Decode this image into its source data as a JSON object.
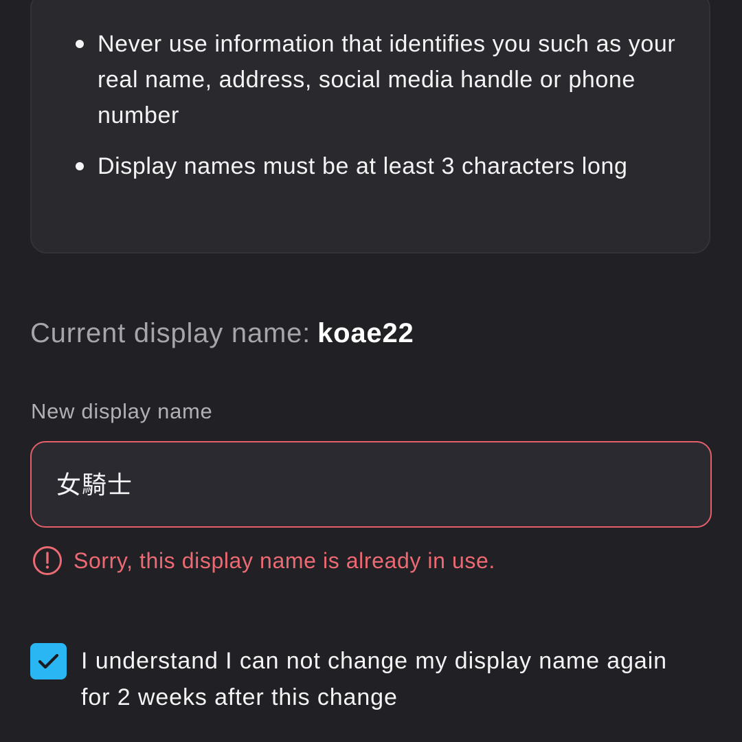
{
  "rules": {
    "items": [
      {
        "text": "Never use information that identifies you such as your real name, address, social media handle or phone number"
      },
      {
        "text": "Display names must be at least 3 characters long"
      }
    ]
  },
  "current_name": {
    "label": "Current display name:",
    "value": "koae22"
  },
  "new_name": {
    "label": "New display name",
    "value": "女騎士",
    "state": "error"
  },
  "error": {
    "icon": "alert-circle-icon",
    "message": "Sorry, this display name is already in use."
  },
  "consent": {
    "checked": true,
    "text": "I understand I can not change my display name again for 2 weeks after this change"
  },
  "colors": {
    "background": "#212024",
    "card": "#2a292e",
    "error": "#e5606b",
    "checkbox": "#2ab6f2"
  }
}
